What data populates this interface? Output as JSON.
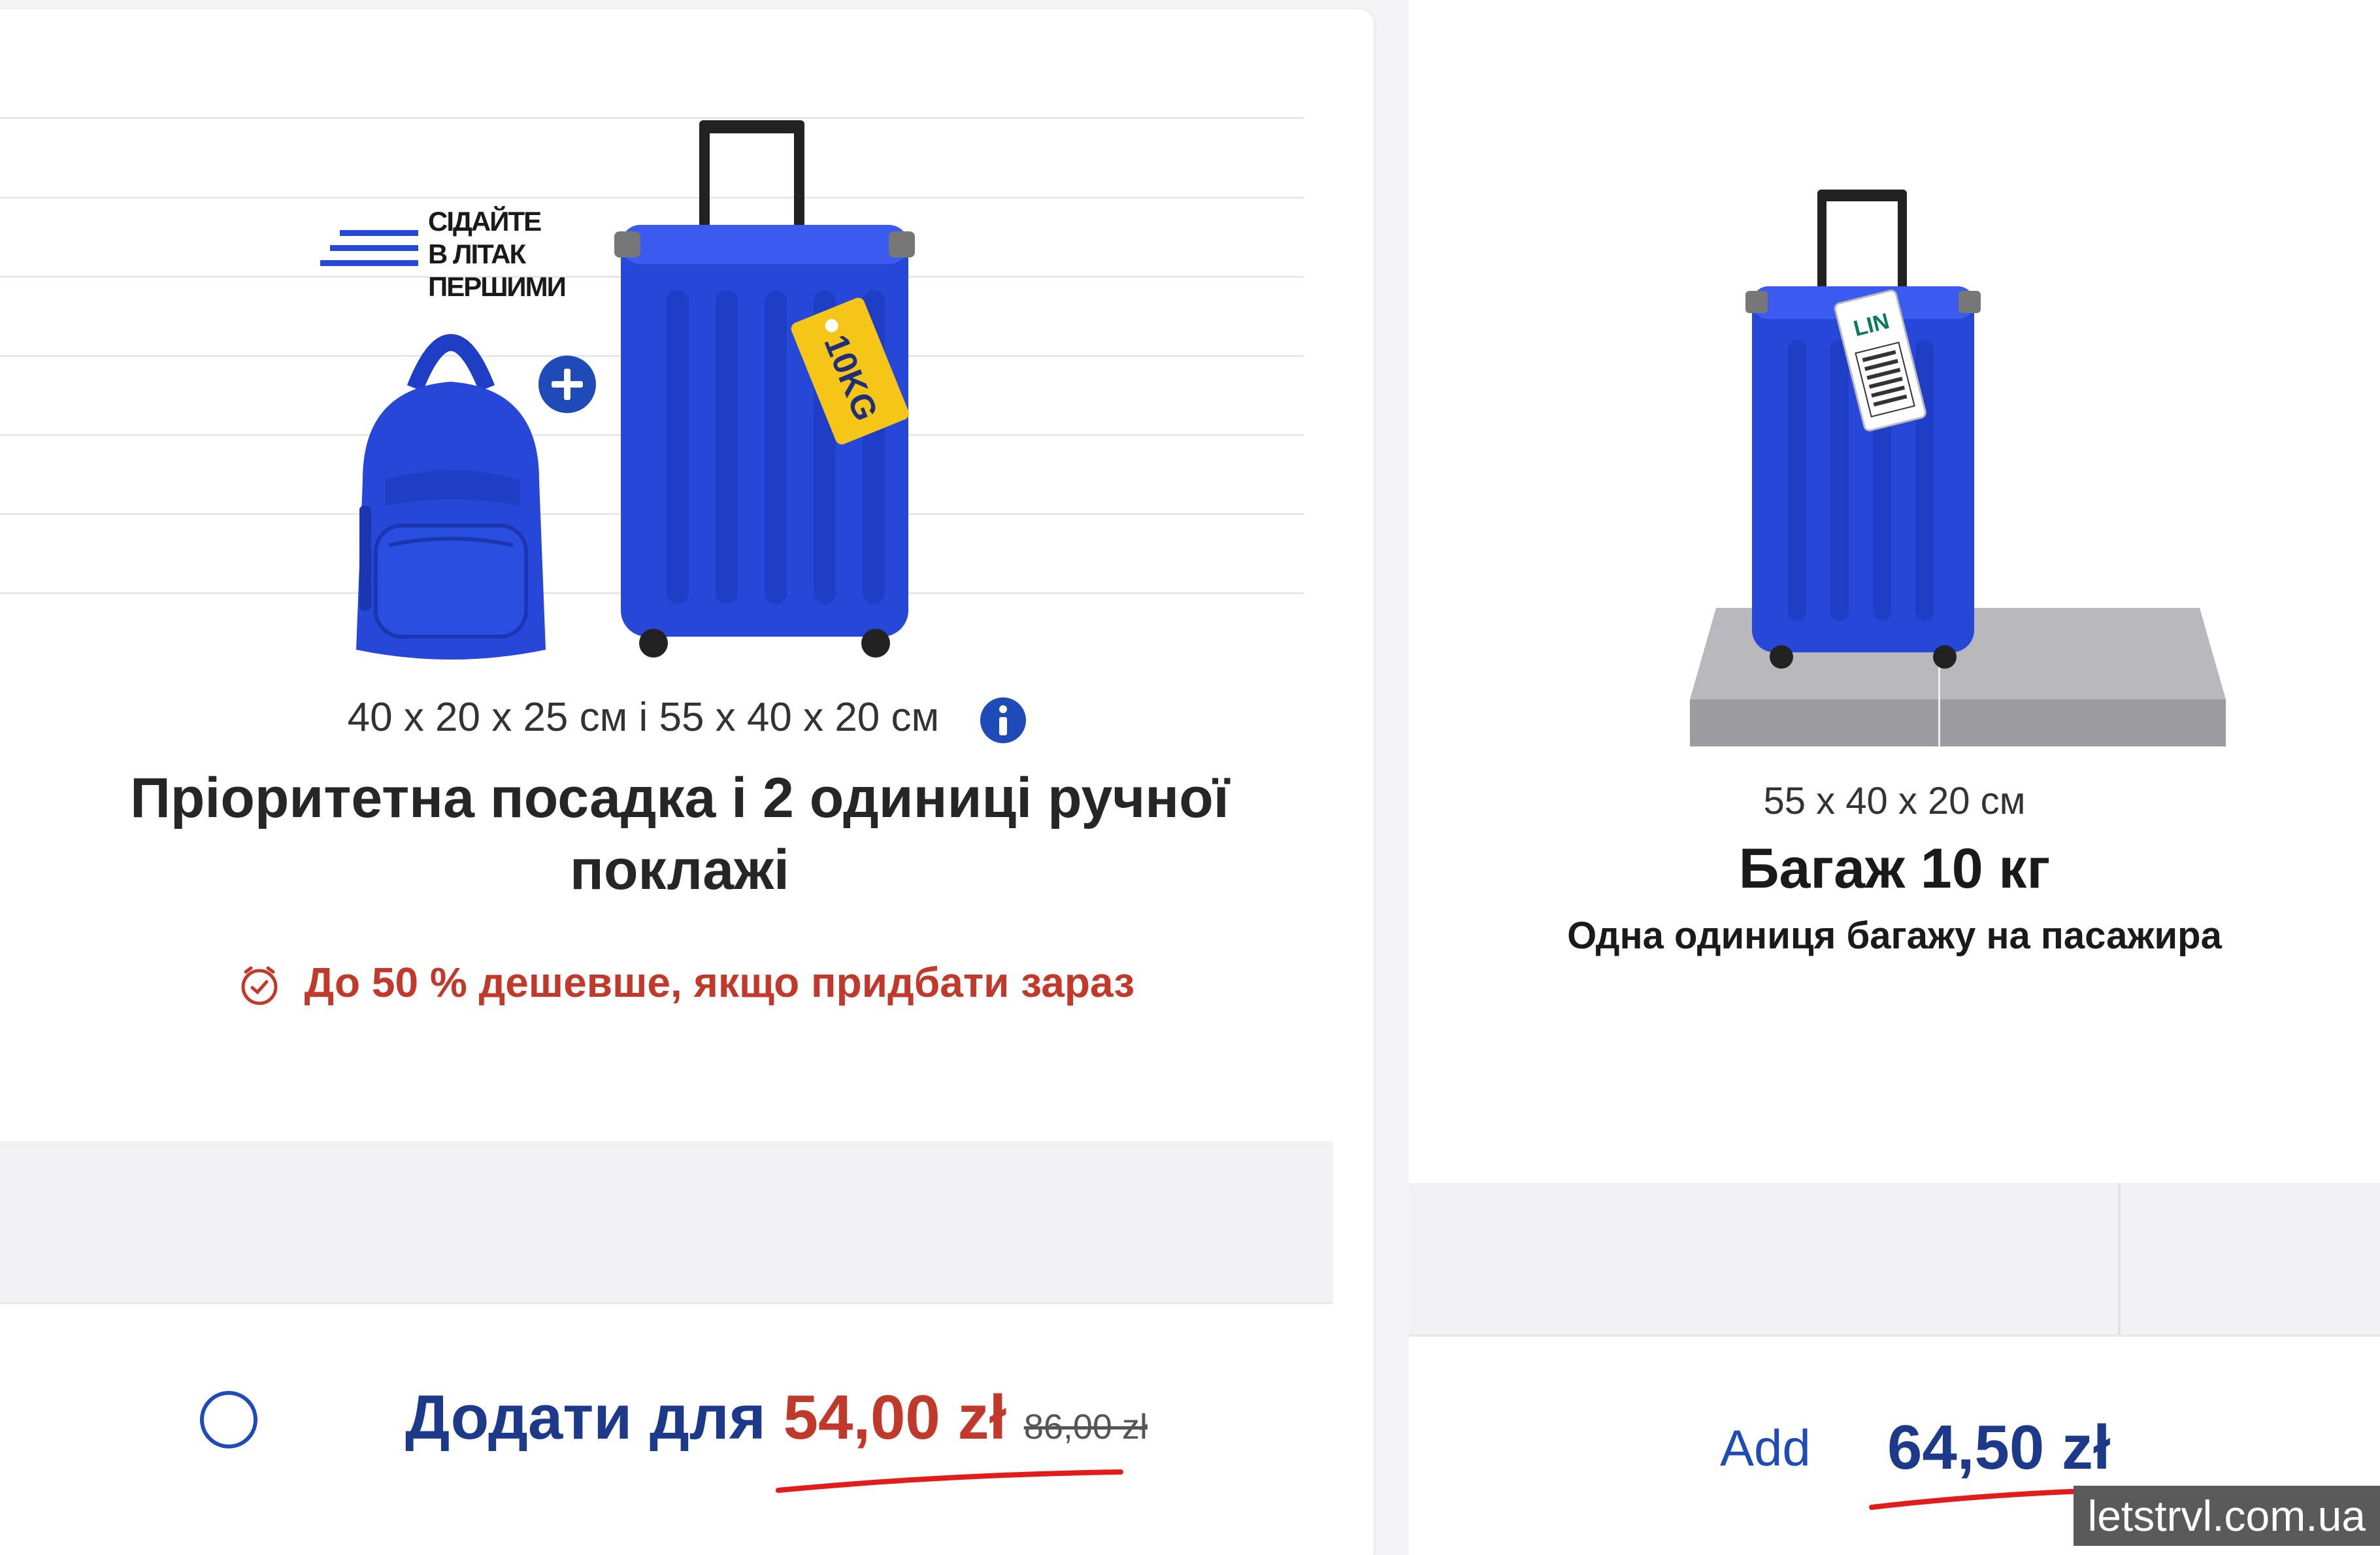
{
  "left": {
    "badge_lines": [
      "СІДАЙТЕ",
      "В ЛІТАК",
      "ПЕРШИМИ"
    ],
    "tag_text": "10KG",
    "dimensions": "40 x 20 x 25 см і 55 x 40 x 20 см",
    "title": "Пріоритетна посадка і 2 одиниці ручної поклажі",
    "promo": "До 50 % дешевше, якщо придбати зараз",
    "add_label": "Додати для",
    "price": "54,00 zł",
    "old_price": "86,00 zł"
  },
  "right": {
    "tag_text": "LIN",
    "dimensions": "55 x 40 x 20 см",
    "title": "Багаж 10 кг",
    "subtitle": "Одна одиниця багажу на пасажира",
    "add_label": "Add",
    "price": "64,50 zł"
  },
  "watermark": "letstrvl.com.ua",
  "colors": {
    "brand_blue": "#1f4bb8",
    "luggage_blue": "#2747d8",
    "price_red": "#c0392b",
    "tag_yellow": "#f5c518"
  }
}
